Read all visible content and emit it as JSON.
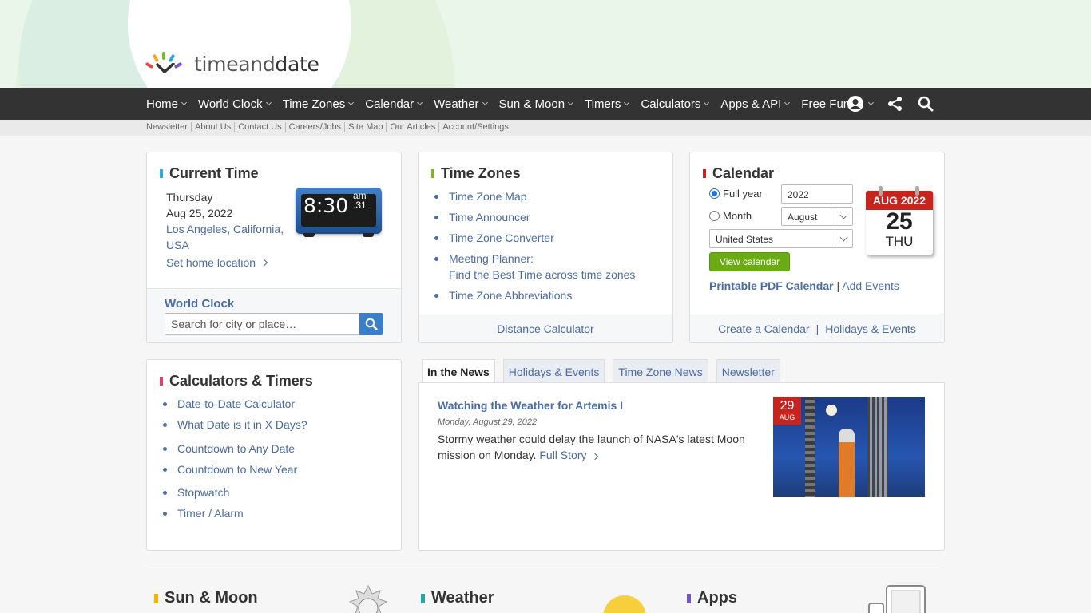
{
  "logo": {
    "text_a": "timeand",
    "text_b": "date"
  },
  "nav": {
    "items": [
      "Home",
      "World Clock",
      "Time Zones",
      "Calendar",
      "Weather",
      "Sun & Moon",
      "Timers",
      "Calculators",
      "Apps & API",
      "Free Fun"
    ],
    "icons": [
      "account-icon",
      "share-icon",
      "search-icon"
    ]
  },
  "subnav": [
    "Newsletter",
    "About Us",
    "Contact Us",
    "Careers/Jobs",
    "Site Map",
    "Our Articles",
    "Account/Settings"
  ],
  "current_time": {
    "title": "Current Time",
    "day": "Thursday",
    "date": "Aug 25, 2022",
    "location_line1": "Los Angeles, California,",
    "location_line2": "USA",
    "set_home": "Set home location",
    "clock_time": "8:30",
    "clock_ampm": "am",
    "clock_seconds": ".31",
    "world_clock_title": "World Clock",
    "search_placeholder": "Search for city or place…"
  },
  "time_zones": {
    "title": "Time Zones",
    "links": [
      "Time Zone Map",
      "Time Announcer",
      "Time Zone Converter",
      "Meeting Planner:",
      "Find the Best Time across time zones",
      "Time Zone Abbreviations"
    ],
    "footer": "Distance Calculator"
  },
  "calendar": {
    "title": "Calendar",
    "full_year_label": "Full year",
    "year_value": "2022",
    "month_label": "Month",
    "month_value": "August",
    "country_value": "United States",
    "view_button": "View calendar",
    "pdf_link": "Printable PDF Calendar",
    "sep": " | ",
    "add_events": "Add Events",
    "footer_create": "Create a Calendar",
    "footer_sep": "|",
    "footer_holidays": "Holidays & Events",
    "icon_month": "AUG",
    "icon_year": "2022",
    "icon_day": "25",
    "icon_dow": "THU"
  },
  "calculators": {
    "title": "Calculators & Timers",
    "links": [
      "Date-to-Date Calculator",
      "What Date is it in X Days?",
      "Countdown to Any Date",
      "Countdown to New Year",
      "Stopwatch",
      "Timer / Alarm"
    ]
  },
  "news": {
    "tabs": [
      "In the News",
      "Holidays & Events",
      "Time Zone News",
      "Newsletter"
    ],
    "active_tab": 0,
    "headline": "Watching the Weather for Artemis I",
    "date": "Monday, August 29, 2022",
    "body": "Stormy weather could delay the launch of NASA's latest Moon mission on Monday.",
    "more": "Full Story",
    "badge_day": "29",
    "badge_month": "AUG"
  },
  "bottom": {
    "sun_moon": "Sun & Moon",
    "weather": "Weather",
    "apps": "Apps"
  },
  "colors": {
    "nav_bg": "#333333",
    "link": "#4a6ba6",
    "green": "#6aaa12",
    "red": "#c8241e"
  }
}
